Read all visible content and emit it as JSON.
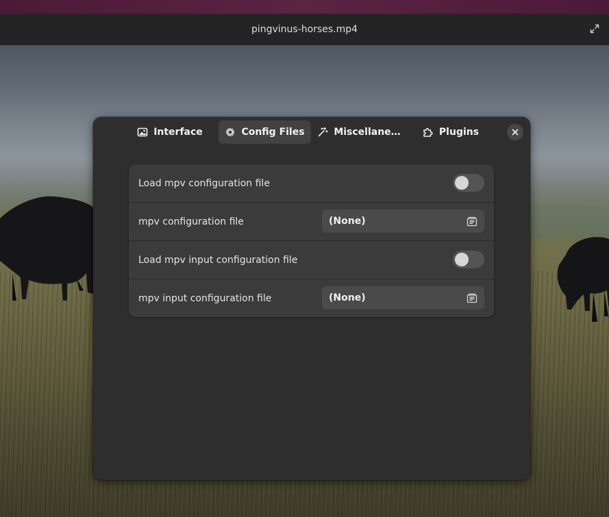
{
  "window": {
    "title": "pingvinus-horses.mp4",
    "icons": {
      "expand": "expand-icon"
    }
  },
  "preferences": {
    "tabs": [
      {
        "label": "Interface",
        "icon": "image-icon",
        "active": false
      },
      {
        "label": "Config Files",
        "icon": "gear-icon",
        "active": true
      },
      {
        "label": "Miscellane…",
        "icon": "wand-icon",
        "active": false
      },
      {
        "label": "Plugins",
        "icon": "puzzle-icon",
        "active": false
      }
    ],
    "close_icon": "close-icon",
    "rows": [
      {
        "label": "Load mpv configuration file",
        "type": "switch",
        "value": false
      },
      {
        "label": "mpv configuration file",
        "type": "file",
        "value": "(None)",
        "icon": "file-chooser-icon"
      },
      {
        "label": "Load mpv input configuration file",
        "type": "switch",
        "value": false
      },
      {
        "label": "mpv input configuration file",
        "type": "file",
        "value": "(None)",
        "icon": "file-chooser-icon"
      }
    ]
  },
  "colors": {
    "headerbar": "#242424",
    "dialog_bg": "#2e2e2e",
    "list_bg": "#3b3b3b",
    "active_tab": "#424242",
    "switch_off": "#545454"
  }
}
